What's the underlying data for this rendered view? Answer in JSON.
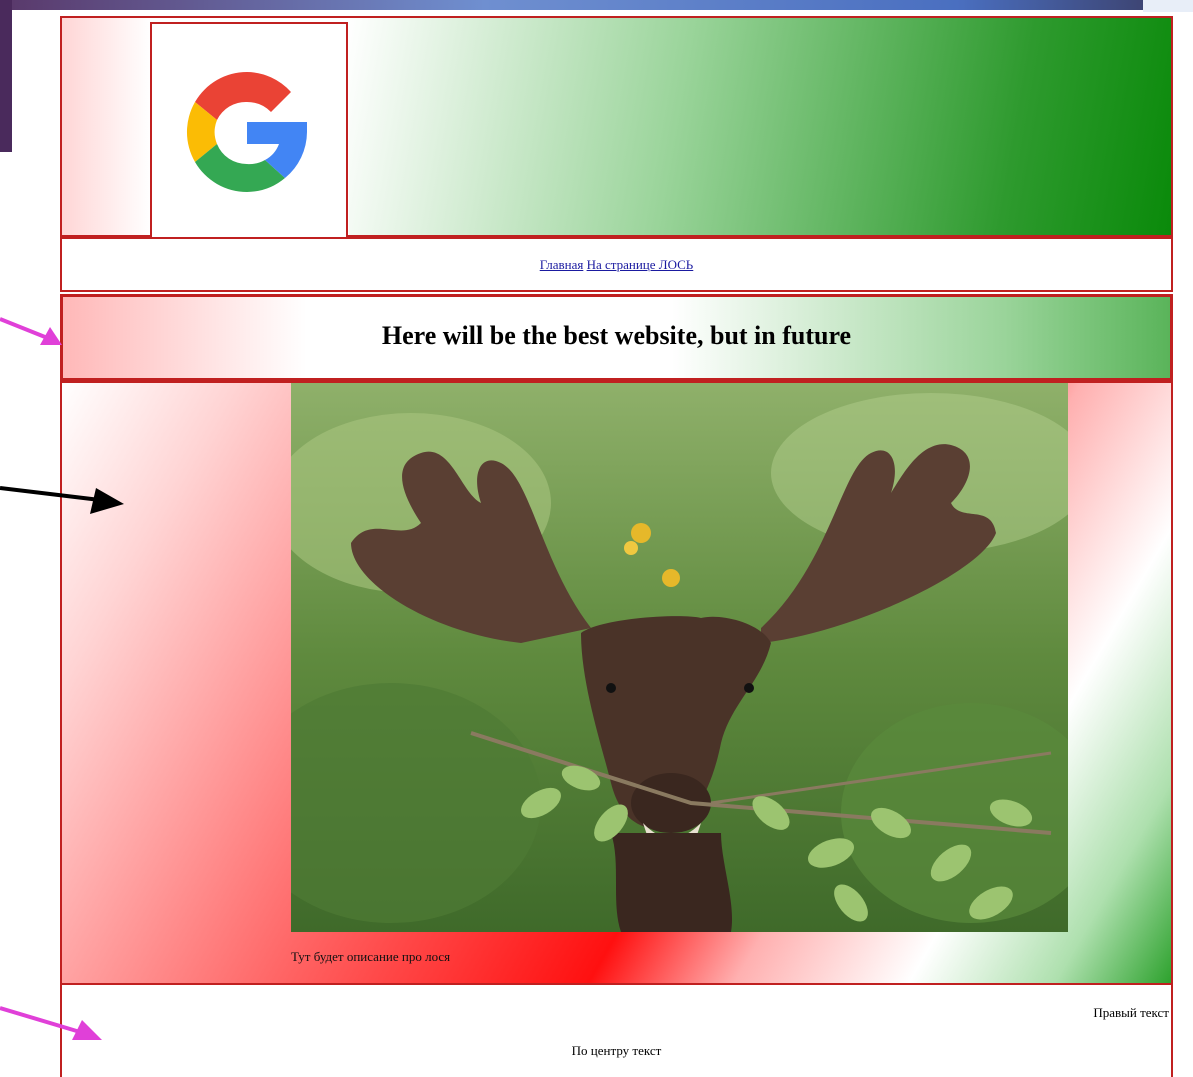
{
  "logo": {
    "icon": "google-g-logo"
  },
  "nav": {
    "home_link": "Главная",
    "moose_link": "На странице ЛОСЬ"
  },
  "banner": {
    "title": "Here will be the best website, but in future"
  },
  "main": {
    "caption": "Тут будет описание про лося"
  },
  "footer": {
    "right_text": "Правый текст",
    "center_text": "По центру текст"
  },
  "colors": {
    "border": "#c02020",
    "link": "#1a1aa0",
    "accent_green": "#0a8a0a",
    "accent_red": "#ff1010",
    "arrow_magenta": "#e040d8"
  }
}
